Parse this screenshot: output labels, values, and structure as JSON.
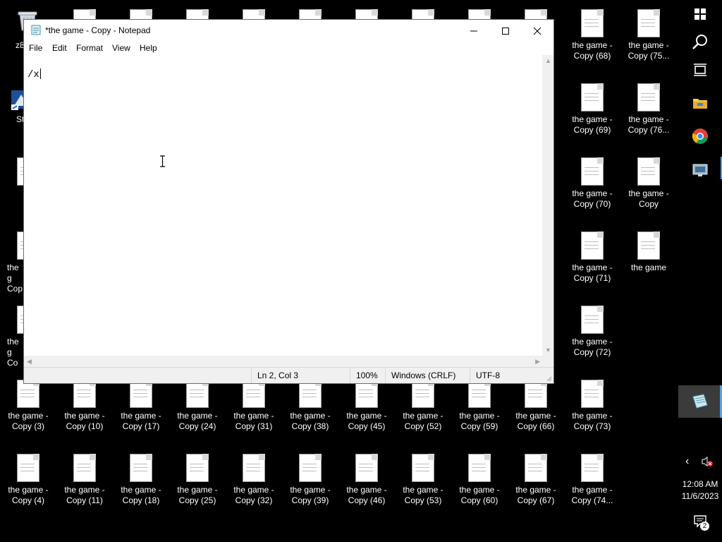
{
  "desktop": {
    "icons": [
      {
        "label": "z8",
        "kind": "recycle"
      },
      {
        "label": "St",
        "kind": "app"
      },
      {
        "label": "the game - Copy (68)"
      },
      {
        "label": "the game - Copy (75..."
      },
      {
        "label": "the game - Copy (69)"
      },
      {
        "label": "the game - Copy (76..."
      },
      {
        "label": "the game - Copy (70)"
      },
      {
        "label": "the game - Copy"
      },
      {
        "label": "the game - Copy (71)"
      },
      {
        "label": "the game"
      },
      {
        "label": "the game - Copy (72)"
      },
      {
        "label": "the g Cop"
      },
      {
        "label": "the g Co"
      },
      {
        "label": "the game - Copy (3)"
      },
      {
        "label": "the game - Copy (10)"
      },
      {
        "label": "the game - Copy (17)"
      },
      {
        "label": "the game - Copy (24)"
      },
      {
        "label": "the game - Copy (31)"
      },
      {
        "label": "the game - Copy (38)"
      },
      {
        "label": "the game - Copy (45)"
      },
      {
        "label": "the game - Copy (52)"
      },
      {
        "label": "the game - Copy (59)"
      },
      {
        "label": "the game - Copy (66)"
      },
      {
        "label": "the game - Copy (73)"
      },
      {
        "label": "the game - Copy (4)"
      },
      {
        "label": "the game - Copy (11)"
      },
      {
        "label": "the game - Copy (18)"
      },
      {
        "label": "the game - Copy (25)"
      },
      {
        "label": "the game - Copy (32)"
      },
      {
        "label": "the game - Copy (39)"
      },
      {
        "label": "the game - Copy (46)"
      },
      {
        "label": "the game - Copy (53)"
      },
      {
        "label": "the game - Copy (60)"
      },
      {
        "label": "the game - Copy (67)"
      },
      {
        "label": "the game - Copy (74..."
      }
    ]
  },
  "notepad": {
    "title": "*the game - Copy - Notepad",
    "menu": [
      "File",
      "Edit",
      "Format",
      "View",
      "Help"
    ],
    "content": "/x",
    "status": {
      "position": "Ln 2, Col 3",
      "zoom": "100%",
      "line_ending": "Windows (CRLF)",
      "encoding": "UTF-8"
    }
  },
  "taskbar": {
    "time": "12:08 AM",
    "date": "11/6/2023",
    "notification_count": "2",
    "accent_color": "#5aa0e6"
  }
}
